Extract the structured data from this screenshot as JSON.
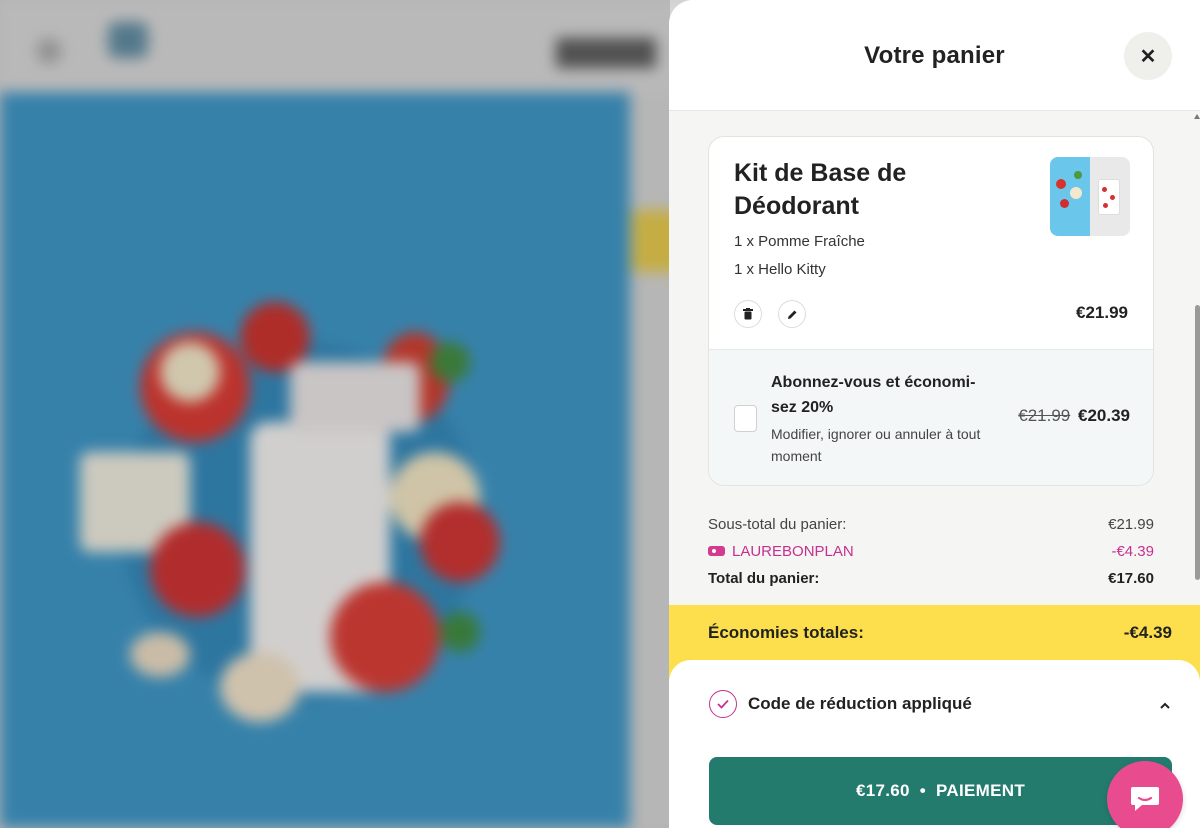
{
  "cart": {
    "title": "Votre panier",
    "close_icon": "close-icon",
    "item": {
      "name": "Kit de Base de Déodorant",
      "variants": [
        "1 x Pomme Fraîche",
        "1 x Hello Kitty"
      ],
      "price": "€21.99",
      "delete_icon": "trash-icon",
      "edit_icon": "pencil-icon"
    },
    "subscription": {
      "title": "Abonnez-vous et économi-sez 20%",
      "description": "Modifier, ignorer ou annuler à tout moment",
      "old_price": "€21.99",
      "new_price": "€20.39",
      "checked": false
    },
    "totals": {
      "subtotal_label": "Sous-total du panier:",
      "subtotal_value": "€21.99",
      "discount_code": "LAUREBONPLAN",
      "discount_value": "-€4.39",
      "total_label": "Total du panier:",
      "total_value": "€17.60"
    },
    "savings": {
      "label": "Économies totales:",
      "value": "-€4.39"
    },
    "discount_section": {
      "label": "Code de réduction appliqué",
      "icon": "check-circle-icon",
      "expanded": true
    },
    "checkout": {
      "amount": "€17.60",
      "separator": "•",
      "label": "PAIEMENT"
    }
  },
  "chat": {
    "icon": "chat-bubble-icon"
  },
  "colors": {
    "accent_teal": "#237b6e",
    "savings_yellow": "#fddf4d",
    "discount_pink": "#c6308f",
    "chat_pink": "#e94b8f"
  }
}
